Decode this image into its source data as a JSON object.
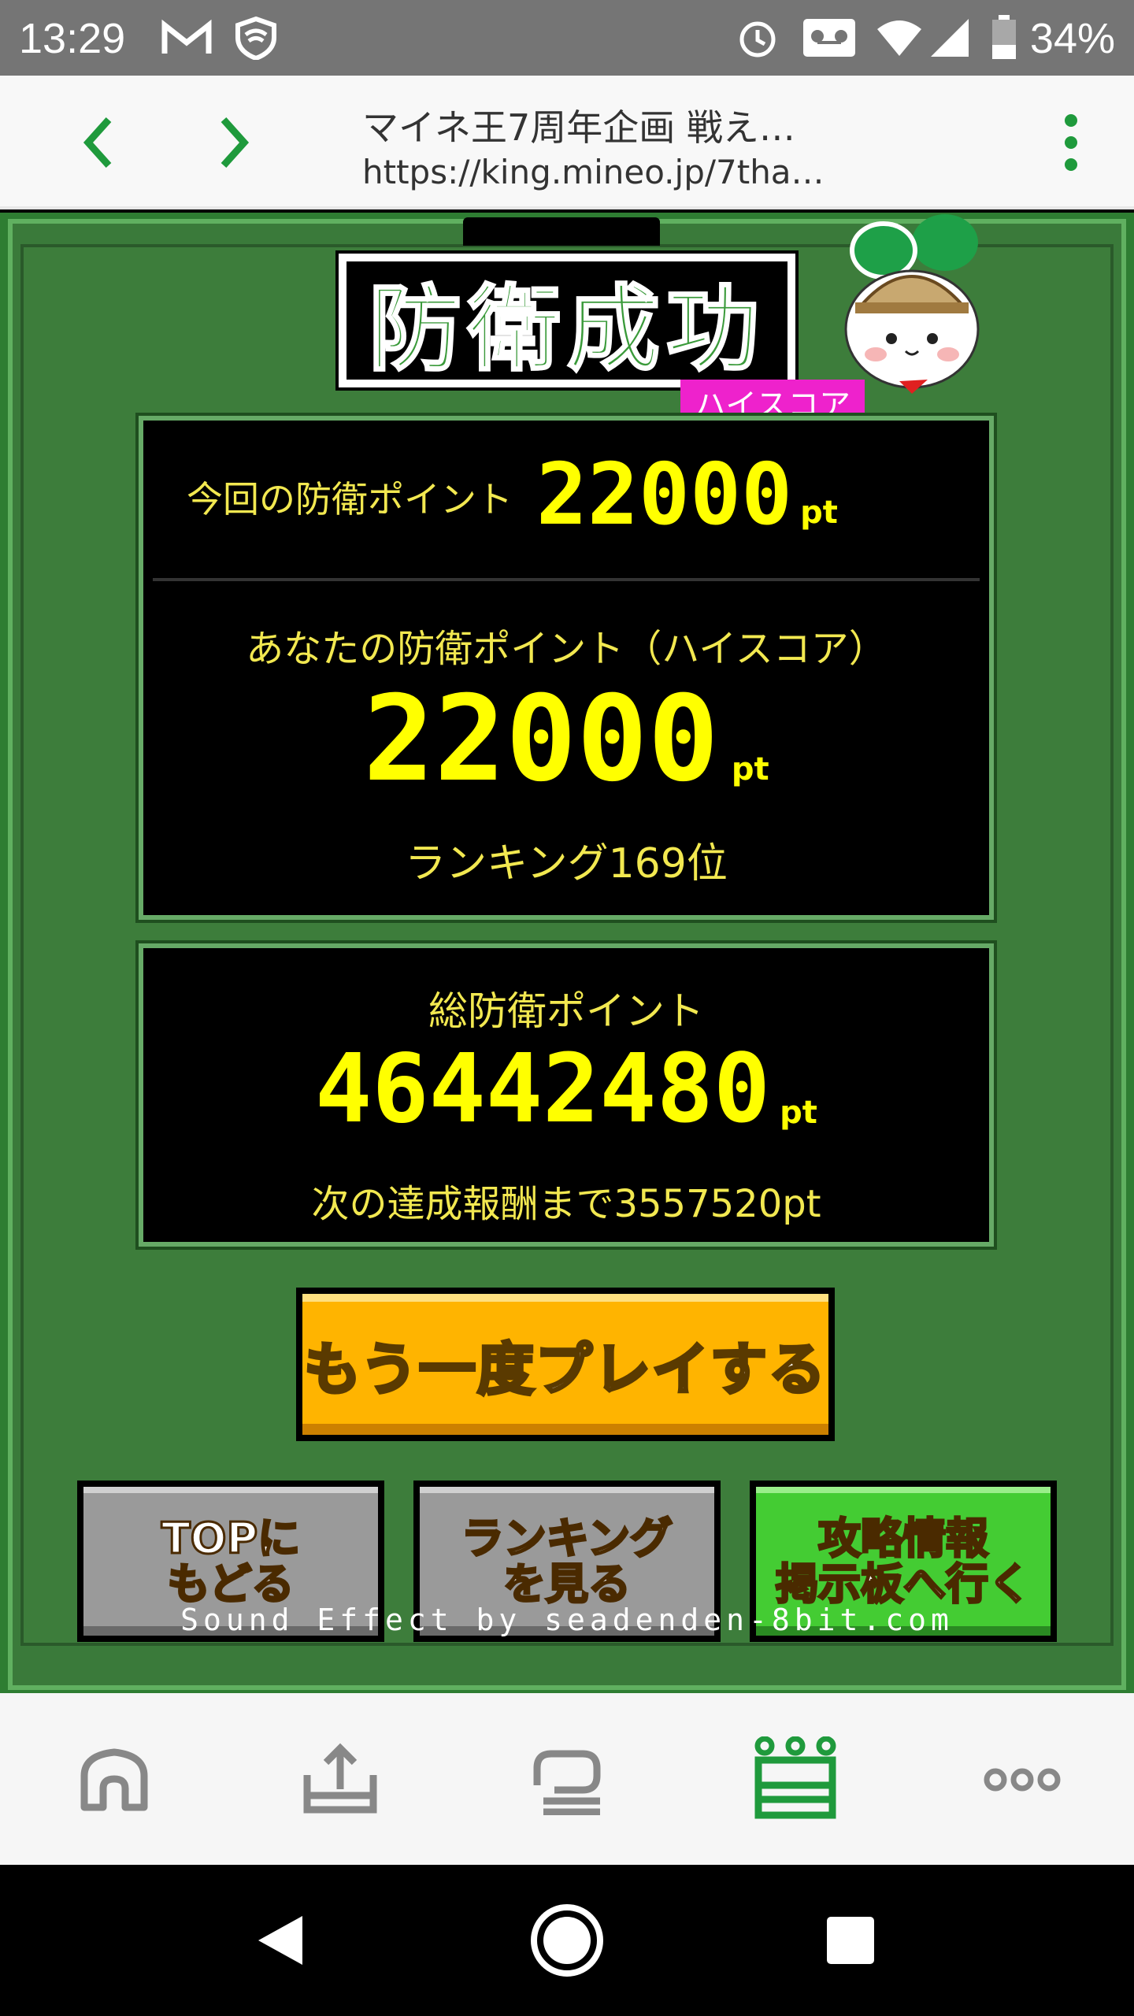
{
  "status_bar": {
    "time": "13:29",
    "battery": "34%",
    "icons": [
      "gmail-icon",
      "shield-icon",
      "alarm-icon",
      "voicemail-icon",
      "wifi-icon",
      "signal-icon",
      "battery-icon"
    ]
  },
  "browser": {
    "title": "マイネ王7周年企画 戦え…",
    "url": "https://king.mineo.jp/7tha…",
    "accent": "#1f9a3c"
  },
  "game": {
    "title": "防衛成功",
    "hiscore_badge": "ハイスコア",
    "current_label": "今回の防衛ポイント",
    "current_value": "22000",
    "unit": "pt",
    "highscore_label": "あなたの防衛ポイント（ハイスコア）",
    "highscore_value": "22000",
    "ranking": "ランキング169位",
    "total_label": "総防衛ポイント",
    "total_value": "46442480",
    "next_reward": "次の達成報酬まで3557520pt",
    "replay_label": "もう一度プレイする",
    "btn_top": "TOPに\nもどる",
    "btn_ranking": "ランキング\nを見る",
    "btn_board": "攻略情報\n掲示板へ行く",
    "credit": "Sound Effect by seadenden-8bit.com"
  },
  "app_nav": {
    "items": [
      "home-icon",
      "upload-icon",
      "chat-icon",
      "crown-icon",
      "more-icon"
    ],
    "active": "crown-icon"
  }
}
